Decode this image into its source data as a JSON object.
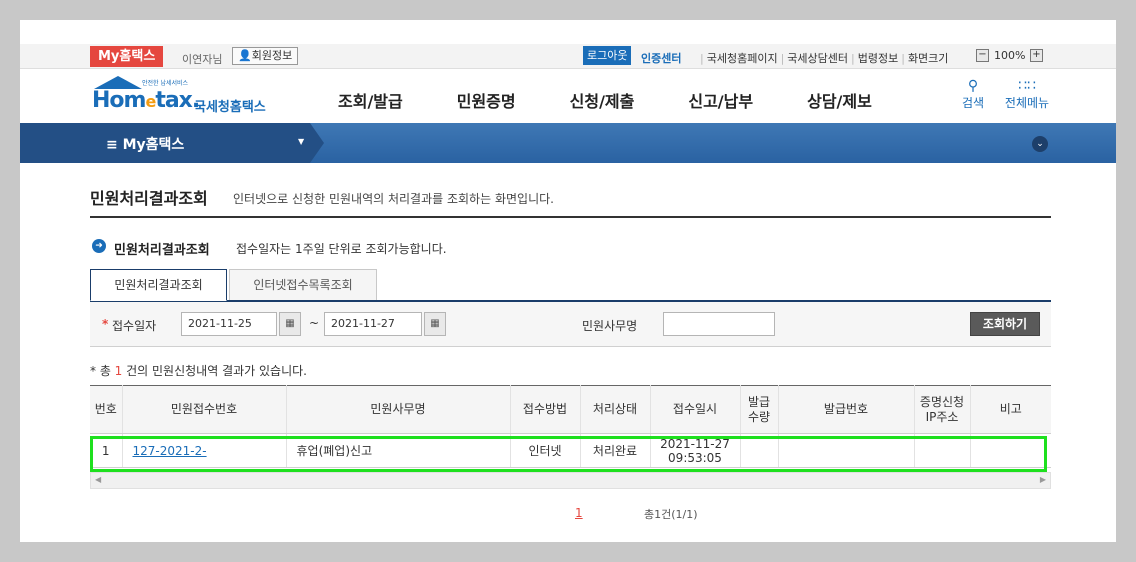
{
  "topbar": {
    "my_badge": "My홈택스",
    "user_name": "이연자님",
    "member_info": "회원정보",
    "logout": "로그아웃",
    "cert_center": "인증센터",
    "links": [
      "국세청홈페이지",
      "국세상담센터",
      "법령정보",
      "화면크기"
    ],
    "zoom_minus": "−",
    "zoom_value": "100%",
    "zoom_plus": "+"
  },
  "header": {
    "logo_tiny": "안전한 납세서비스",
    "logo_home": "Hom",
    "logo_e": "e",
    "logo_tax": "tax.",
    "logo_kname": "국세청홈택스",
    "gnb": [
      "조회/발급",
      "민원증명",
      "신청/제출",
      "신고/납부",
      "상담/제보"
    ],
    "search_label": "검색",
    "menu_label": "전체메뉴"
  },
  "navband": {
    "title": "≡  My홈택스"
  },
  "page": {
    "title": "민원처리결과조회",
    "description": "인터넷으로 신청한 민원내역의 처리결과를 조회하는 화면입니다.",
    "section_title": "민원처리결과조회",
    "section_desc": "접수일자는 1주일 단위로 조회가능합니다."
  },
  "tabs": [
    {
      "label": "민원처리결과조회",
      "active": true
    },
    {
      "label": "인터넷접수목록조회",
      "active": false
    }
  ],
  "search": {
    "required_mark": "*",
    "date_label": "접수일자",
    "date_from": "2021-11-25",
    "date_to": "2021-11-27",
    "tilde": "~",
    "work_label": "민원사무명",
    "work_value": "",
    "query_button": "조회하기"
  },
  "result": {
    "prefix": "* 총 ",
    "count": "1",
    "suffix": " 건의 민원신청내역 결과가 있습니다."
  },
  "table": {
    "headers": [
      "번호",
      "민원접수번호",
      "민원사무명",
      "접수방법",
      "처리상태",
      "접수일시",
      "발급\n수량",
      "발급번호",
      "증명신청\nIP주소",
      "비고"
    ],
    "rows": [
      {
        "no": "1",
        "receipt_no": "127-2021-2-",
        "work_name": "휴업(폐업)신고",
        "method": "인터넷",
        "status": "처리완료",
        "received_date": "2021-11-27",
        "received_time": "09:53:05",
        "issue_qty": "",
        "issue_no": "",
        "ip": "",
        "note": ""
      }
    ]
  },
  "pager": {
    "current": "1",
    "total": "총1건(1/1)"
  },
  "colors": {
    "accent_blue": "#1a6db8",
    "my_badge_red": "#e5473f",
    "highlight_green": "#1ee01e"
  }
}
